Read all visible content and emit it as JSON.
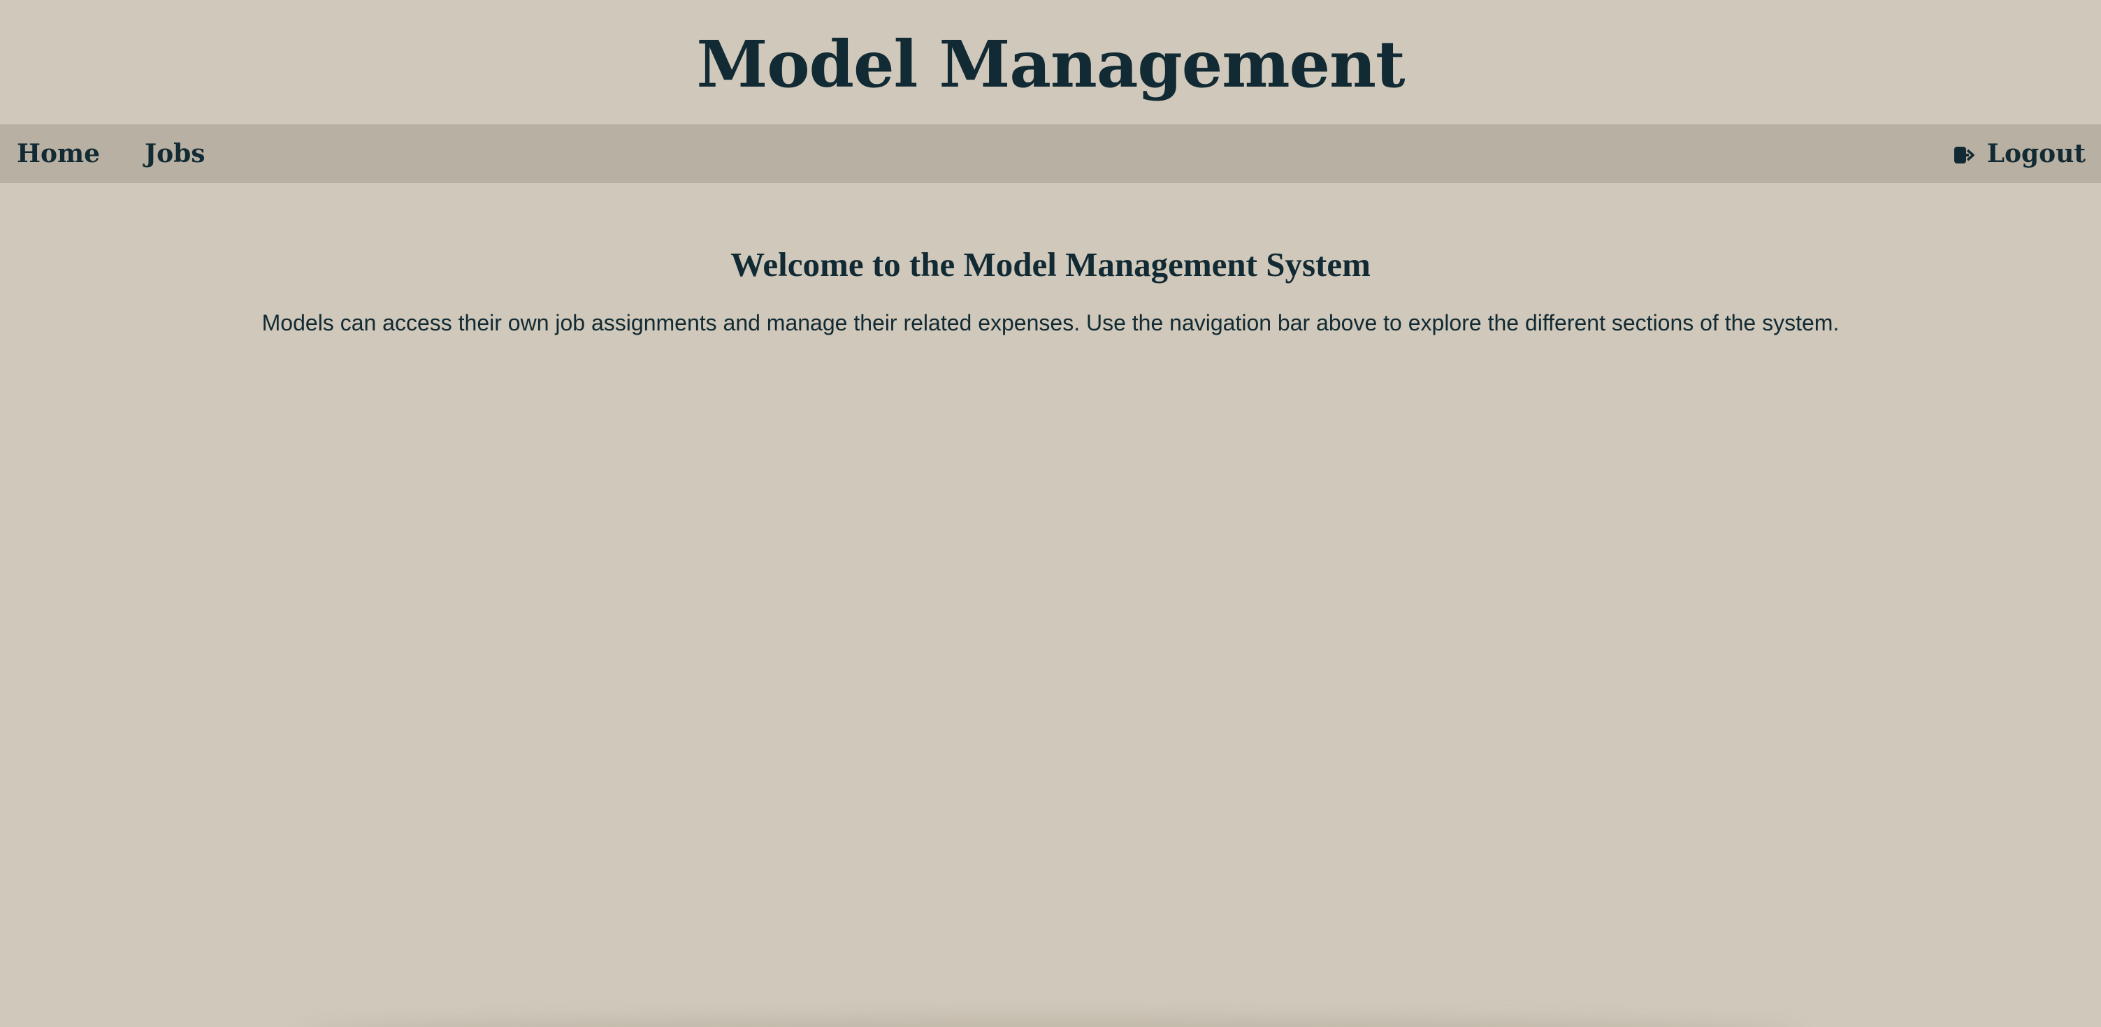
{
  "header": {
    "title": "Model Management"
  },
  "nav": {
    "items": [
      {
        "label": "Home"
      },
      {
        "label": "Jobs"
      }
    ],
    "logout": {
      "label": "Logout",
      "icon": "logout-icon"
    }
  },
  "main": {
    "heading": "Welcome to the Model Management System",
    "description": "Models can access their own job assignments and manage their related expenses. Use the navigation bar above to explore the different sections of the system."
  },
  "colors": {
    "background": "#d0c9bb",
    "navbar": "#b8b0a3",
    "text": "#122a33"
  }
}
